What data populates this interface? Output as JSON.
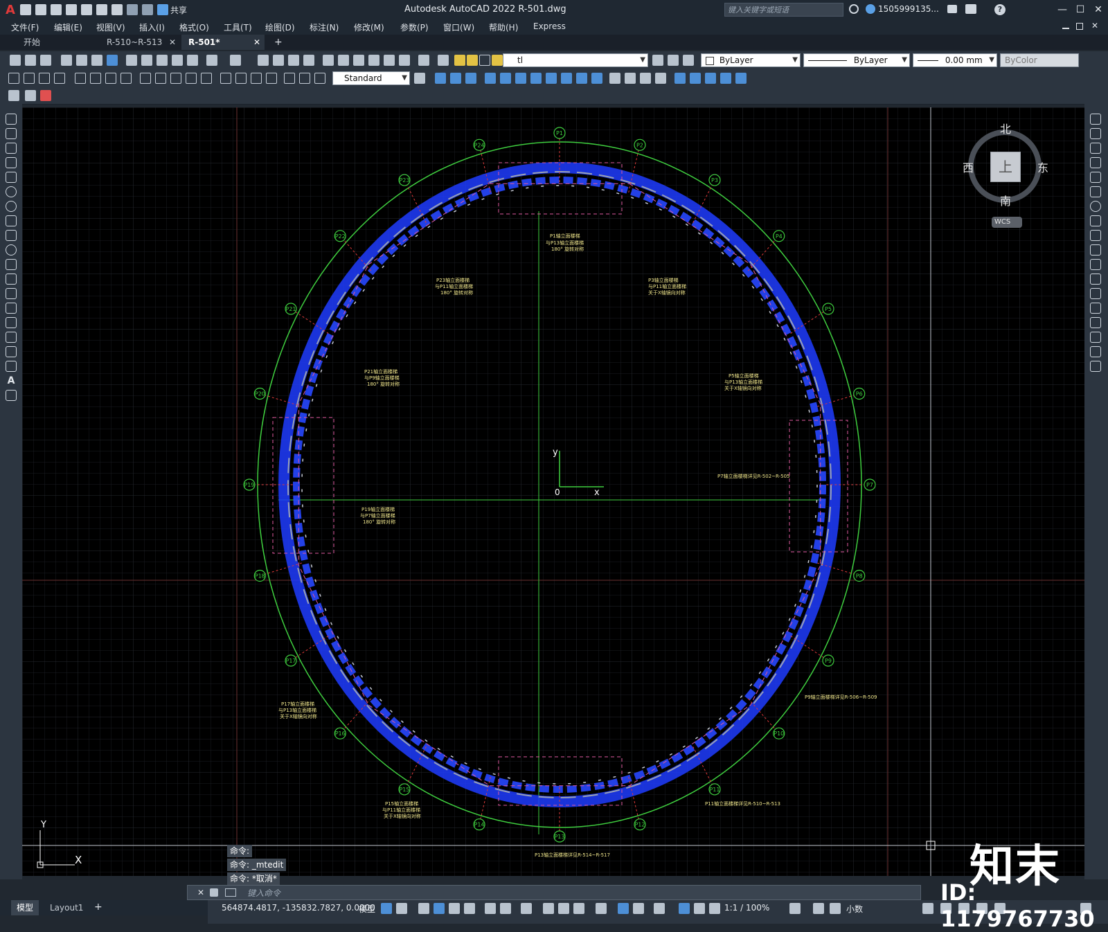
{
  "app": {
    "title": "Autodesk AutoCAD 2022    R-501.dwg",
    "logo": "A",
    "share_label": "共享",
    "search_placeholder": "键入关键字或短语",
    "user": "1505999135...",
    "window_controls": [
      "—",
      "☐",
      "✕"
    ]
  },
  "menu": [
    "文件(F)",
    "编辑(E)",
    "视图(V)",
    "插入(I)",
    "格式(O)",
    "工具(T)",
    "绘图(D)",
    "标注(N)",
    "修改(M)",
    "参数(P)",
    "窗口(W)",
    "帮助(H)",
    "Express"
  ],
  "tabs": [
    {
      "label": "开始",
      "active": false,
      "closable": false
    },
    {
      "label": "R-510~R-513",
      "active": false,
      "closable": true
    },
    {
      "label": "R-501*",
      "active": true,
      "closable": true
    }
  ],
  "tab_add": "+",
  "tab_close_glyph": "✕",
  "layer_combo": "tl",
  "color_combo": "ByLayer",
  "linetype_combo": "ByLayer",
  "lineweight_combo": "0.00 mm",
  "plotstyle_combo": "ByColor",
  "dimstyle_combo": "Standard",
  "viewcube": {
    "north": "北",
    "south": "南",
    "east": "东",
    "west": "西",
    "top": "上",
    "wcs": "WCS"
  },
  "drawing": {
    "ucs_y": "Y",
    "ucs_x_marker": "X",
    "origin_y": "y",
    "origin_x": "x",
    "origin_0": "0",
    "grid_labels": [
      "P1",
      "P2",
      "P3",
      "P4",
      "P5",
      "P6",
      "P7",
      "P8",
      "P9",
      "P10",
      "P11",
      "P12",
      "P13",
      "P14",
      "P15",
      "P16",
      "P17",
      "P18",
      "P19",
      "P20",
      "P21",
      "P22",
      "P23",
      "P24"
    ],
    "notes": [
      "P1轴立面楼梯",
      "与P13轴立面楼梯",
      "180° 旋转对称",
      "P23轴立面楼梯",
      "与P11轴立面楼梯",
      "P3轴立面楼梯",
      "关于X轴镜向对称",
      "P21轴立面楼梯",
      "与P9轴立面楼梯",
      "P5轴立面楼梯",
      "P19轴立面楼梯",
      "与P7轴立面楼梯",
      "P7轴立面楼梯详见R-502~R-505",
      "P17轴立面楼梯",
      "P9轴立面楼梯详见R-506~R-509",
      "P15轴立面楼梯",
      "P11轴立面楼梯详见R-510~R-513",
      "P13轴立面楼梯详见R-514~R-517"
    ]
  },
  "command": {
    "history": [
      "命令:",
      "命令: _mtedit",
      "命令: *取消*"
    ],
    "placeholder": "键入命令"
  },
  "layouts": [
    {
      "label": "模型",
      "active": true
    },
    {
      "label": "Layout1",
      "active": false
    }
  ],
  "layout_add": "+",
  "status": {
    "coords": "564874.4817, -135832.7827, 0.0000",
    "mode": "模型",
    "scale": "1:1 / 100%",
    "units": "小数"
  },
  "watermark": {
    "brand": "知末",
    "id": "ID: 1179767730"
  }
}
